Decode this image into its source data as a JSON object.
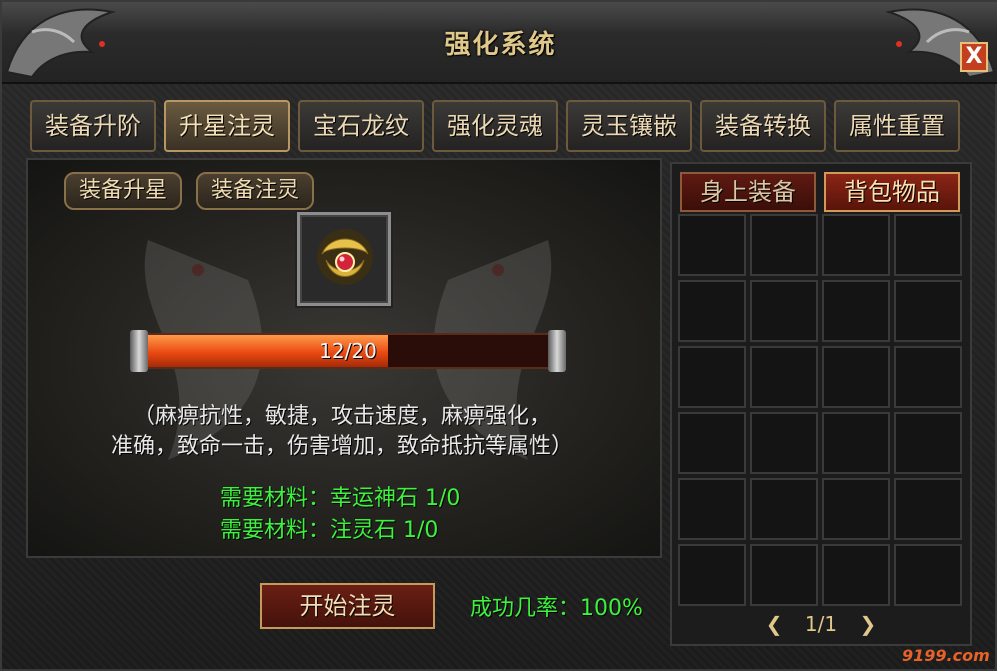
{
  "window": {
    "title": "强化系统",
    "close_label": "X"
  },
  "tabs": [
    {
      "label": "装备升阶",
      "active": false
    },
    {
      "label": "升星注灵",
      "active": true
    },
    {
      "label": "宝石龙纹",
      "active": false
    },
    {
      "label": "强化灵魂",
      "active": false
    },
    {
      "label": "灵玉镶嵌",
      "active": false
    },
    {
      "label": "装备转换",
      "active": false
    },
    {
      "label": "属性重置",
      "active": false
    }
  ],
  "subtabs": [
    {
      "label": "装备升星"
    },
    {
      "label": "装备注灵"
    }
  ],
  "item_slot": {
    "icon": "golden-amulet-icon"
  },
  "progress": {
    "text": "12/20",
    "current": 12,
    "max": 20
  },
  "description": {
    "line1": "（麻痹抗性，敏捷，攻击速度，麻痹强化，",
    "line2": "准确，致命一击，伤害增加，致命抵抗等属性）"
  },
  "materials": [
    {
      "text": "需要材料：幸运神石 1/0"
    },
    {
      "text": "需要材料：注灵石 1/0"
    }
  ],
  "action": {
    "button_label": "开始注灵",
    "success_rate": "成功几率：100%"
  },
  "inventory": {
    "tabs": [
      {
        "label": "身上装备",
        "active": false
      },
      {
        "label": "背包物品",
        "active": true
      }
    ],
    "rows": 6,
    "cols": 4,
    "page": "1/1",
    "prev_icon": "chevron-left-icon",
    "next_icon": "chevron-right-icon"
  },
  "watermark": "9199.com",
  "colors": {
    "accent_green": "#3cf23c",
    "title_gold": "#e0c78a",
    "progress_fill": "#ea4a12"
  }
}
